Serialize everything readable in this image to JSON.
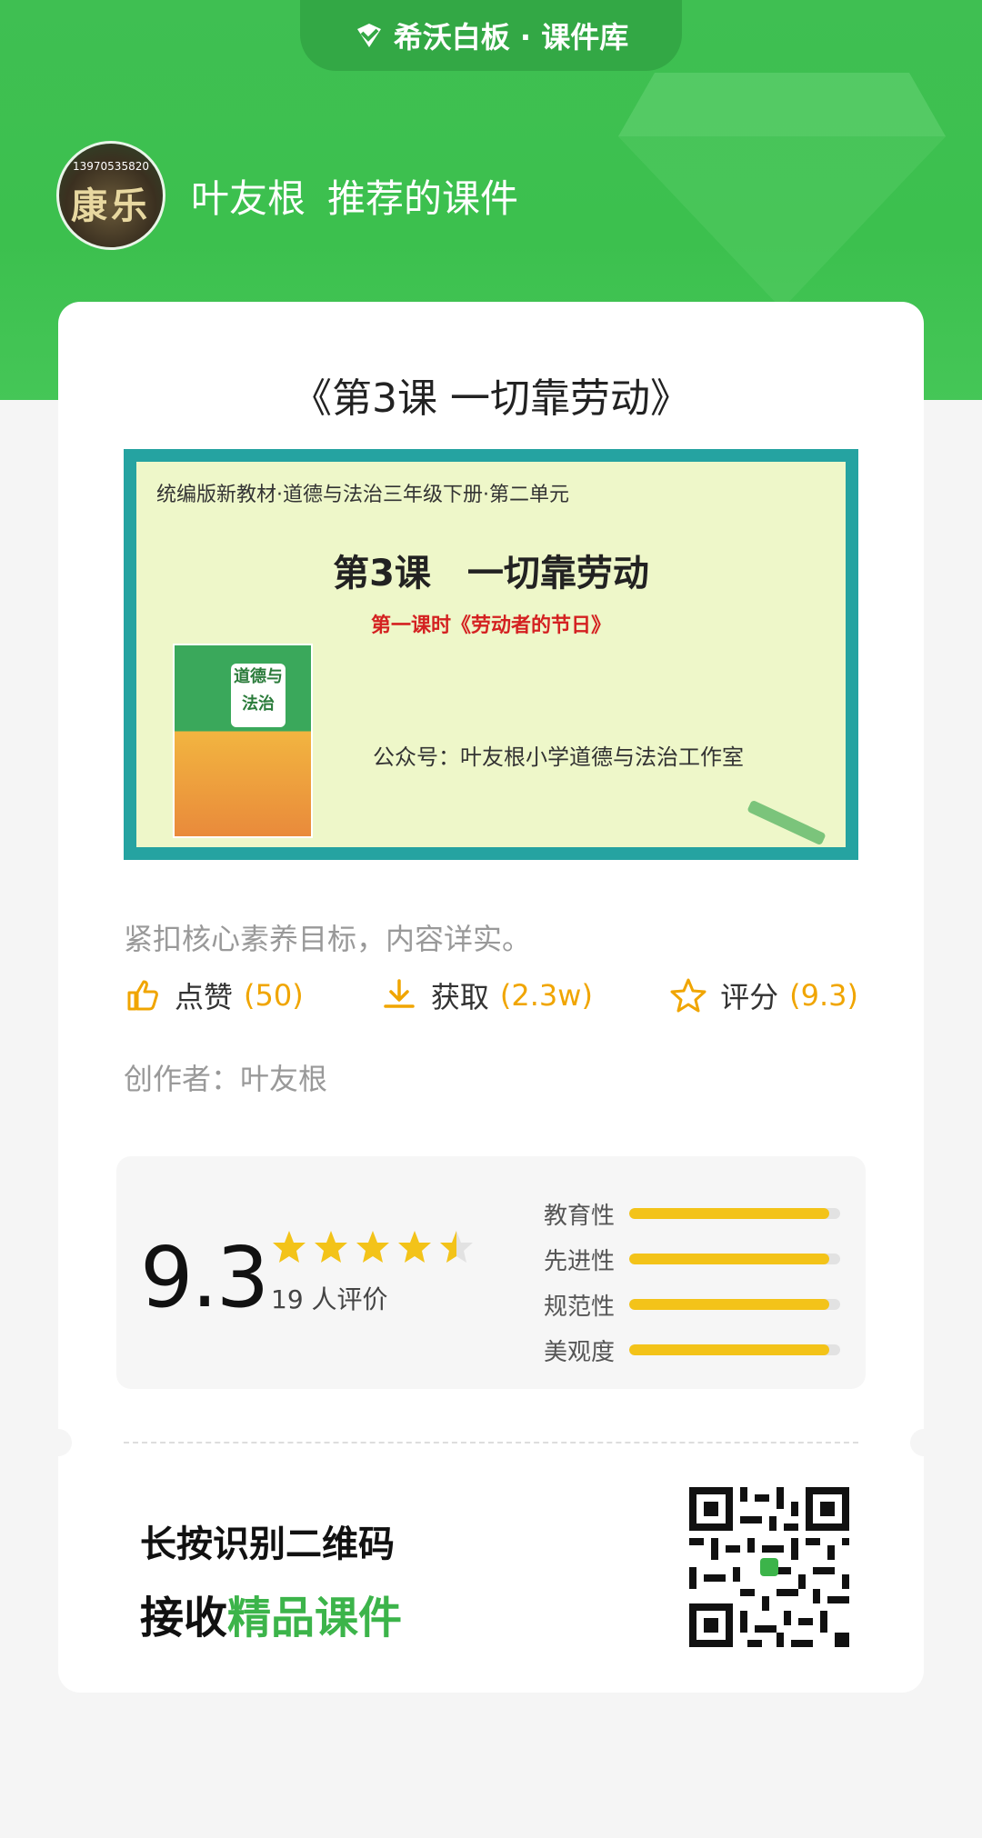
{
  "brand": {
    "label": "希沃白板 · 课件库"
  },
  "recommender": {
    "avatar_phone": "13970535820",
    "avatar_text": "康乐",
    "name": "叶友根",
    "suffix": "推荐的课件"
  },
  "course": {
    "title": "《第3课 一切靠劳动》",
    "cover": {
      "edition": "统编版新教材·道德与法治三年级下册·第二单元",
      "lesson": "第3课　一切靠劳动",
      "sub": "第一课时《劳动者的节日》",
      "wechat": "公众号：叶友根小学道德与法治工作室",
      "book_title": "道德与法治"
    },
    "description": "紧扣核心素养目标，内容详实。",
    "stats": [
      {
        "icon": "thumbs-up-icon",
        "label": "点赞",
        "value": "(50)"
      },
      {
        "icon": "download-icon",
        "label": "获取",
        "value": "(2.3w)"
      },
      {
        "icon": "star-outline-icon",
        "label": "评分",
        "value": "(9.3)"
      }
    ],
    "author": "创作者：叶友根"
  },
  "rating": {
    "score": "9.3",
    "stars": 4.5,
    "reviews": "19 人评价",
    "dimensions": [
      {
        "label": "教育性",
        "value": 0.95
      },
      {
        "label": "先进性",
        "value": 0.95
      },
      {
        "label": "规范性",
        "value": 0.95
      },
      {
        "label": "美观度",
        "value": 0.95
      }
    ]
  },
  "qr": {
    "line1": "长按识别二维码",
    "line2_prefix": "接收",
    "line2_highlight": "精品课件"
  },
  "colors": {
    "brand_green": "#3cc04e",
    "accent_orange": "#f0a500",
    "star_yellow": "#f3c319"
  }
}
